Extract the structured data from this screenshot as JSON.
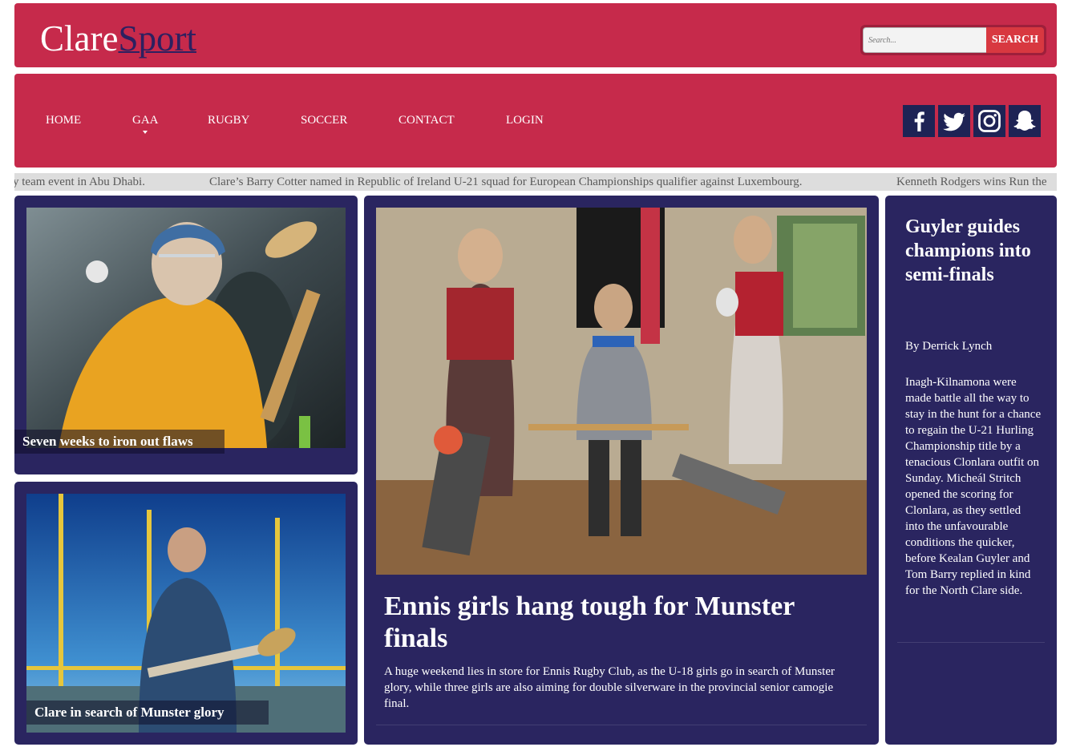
{
  "site": {
    "brand_clare": "Clare",
    "brand_sport": "Sport"
  },
  "search": {
    "placeholder": "Search...",
    "button_label": "SEARCH"
  },
  "nav": {
    "items": [
      {
        "label": "HOME"
      },
      {
        "label": "GAA"
      },
      {
        "label": "RUGBY"
      },
      {
        "label": "SOCCER"
      },
      {
        "label": "CONTACT"
      },
      {
        "label": "LOGIN"
      }
    ]
  },
  "social": [
    "facebook-icon",
    "twitter-icon",
    "instagram-icon",
    "snapchat-icon"
  ],
  "ticker": {
    "items": [
      "y team event in Abu Dhabi.",
      "Clare’s Barry Cotter named in Republic of Ireland U-21 squad for European Championships qualifier against Luxembourg.",
      "Kenneth Rodgers wins Run the"
    ]
  },
  "stories": {
    "top_left": {
      "caption": "Seven weeks to iron out flaws"
    },
    "bottom_left": {
      "caption": "Clare in search of Munster glory"
    },
    "feature": {
      "title": "Ennis girls hang tough for Munster finals",
      "excerpt": "A huge weekend lies in store for Ennis Rugby Club, as the U-18 girls go in search of Munster glory, while three girls are also aiming for double silverware in the provincial senior camogie final."
    },
    "sidebar": {
      "title": "Guyler guides champions into semi-finals",
      "byline": "By Derrick Lynch",
      "excerpt": "Inagh-Kilnamona were made battle all the way to stay in the hunt for a chance to regain the U-21 Hurling Championship title by a tenacious Clonlara outfit on Sunday. Micheál Stritch opened the scoring for Clonlara, as they settled into the unfavourable conditions the quicker, before Kealan Guyler and Tom Barry replied in kind for the North Clare side."
    }
  },
  "colors": {
    "brand_red": "#c62a4b",
    "brand_navy": "#2a2560",
    "search_button": "#d83840"
  }
}
